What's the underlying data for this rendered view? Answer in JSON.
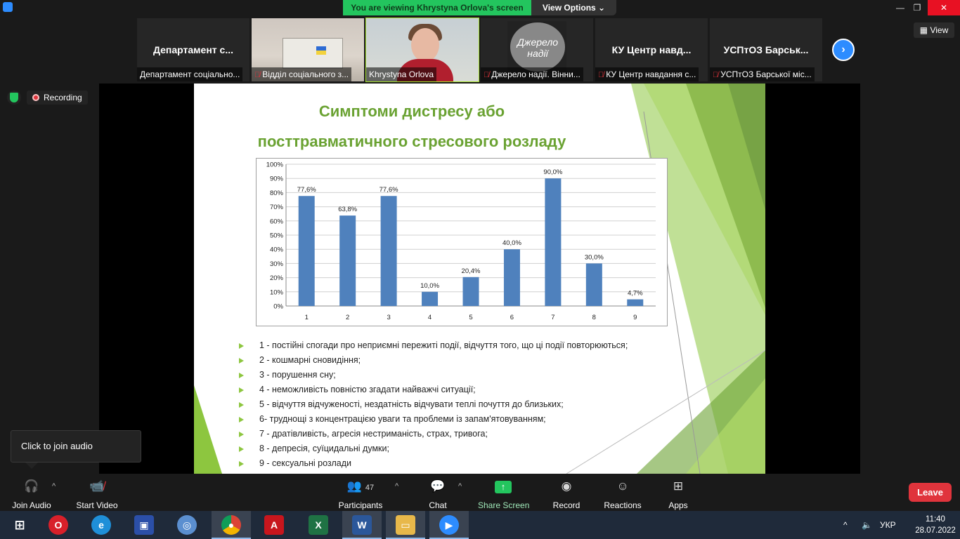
{
  "banner": {
    "text": "You are viewing Khrystyna Orlova's screen",
    "view_options": "View Options ⌄"
  },
  "window": {
    "minimize": "—",
    "restore": "❐",
    "close": "✕"
  },
  "view_button": "View",
  "thumbnails": [
    {
      "name": "Департамент с...",
      "label": "Департамент соціально...",
      "muted": false
    },
    {
      "name": "",
      "label": "Відділ соціального з...",
      "muted": true
    },
    {
      "name": "",
      "label": "Khrystyna Orlova",
      "muted": false
    },
    {
      "name": "",
      "label": "Джерело надії. Вінни...",
      "muted": true,
      "logo": "Джерело надії"
    },
    {
      "name": "КУ Центр навд...",
      "label": "КУ Центр навдання с...",
      "muted": true
    },
    {
      "name": "УСПтОЗ Барськ...",
      "label": "УСПтОЗ Барської міс...",
      "muted": true
    }
  ],
  "recording": "Recording",
  "slide": {
    "title_line1": "Симптоми дистресу або",
    "title_line2": "посттравматичного стресового розладу",
    "legend": [
      "1 - постійні спогади про неприємні пережиті події, відчуття того, що ці події повторюються;",
      "2 - кошмарні сновидіння;",
      "3 - порушення сну;",
      "4 - неможливість повністю згадати найважчі ситуації;",
      "5 - відчуття відчуженості, нездатність відчувати теплі почуття до близьких;",
      "6- труднощі з концентрацією уваги та проблеми із запам'ятовуванням;",
      "7 - дратівливість, агресія нестриманість, страх, тривога;",
      "8 - депресія, суїцидальні думки;",
      "9 - сексуальні розлади"
    ]
  },
  "chart_data": {
    "type": "bar",
    "categories": [
      "1",
      "2",
      "3",
      "4",
      "5",
      "6",
      "7",
      "8",
      "9"
    ],
    "values": [
      77.6,
      63.8,
      77.6,
      10.0,
      20.4,
      40.0,
      90.0,
      30.0,
      4.7
    ],
    "data_labels": [
      "77,6%",
      "63,8%",
      "77,6%",
      "10,0%",
      "20,4%",
      "40,0%",
      "90,0%",
      "30,0%",
      "4,7%"
    ],
    "ylim": [
      0,
      100
    ],
    "y_ticks": [
      "0%",
      "10%",
      "20%",
      "30%",
      "40%",
      "50%",
      "60%",
      "70%",
      "80%",
      "90%",
      "100%"
    ],
    "grid": true,
    "bar_color": "#4f81bd"
  },
  "tooltip": "Click to join audio",
  "toolbar": {
    "join_audio": "Join Audio",
    "start_video": "Start Video",
    "participants": "Participants",
    "participants_count": "47",
    "chat": "Chat",
    "share_screen": "Share Screen",
    "record": "Record",
    "reactions": "Reactions",
    "apps": "Apps",
    "leave": "Leave"
  },
  "taskbar": {
    "language": "УКР",
    "time": "11:40",
    "date": "28.07.2022"
  },
  "colors": {
    "accent": "#2d8cff",
    "share_green": "#23c55e",
    "leave_red": "#e0343c",
    "slide_green": "#6aa232"
  }
}
